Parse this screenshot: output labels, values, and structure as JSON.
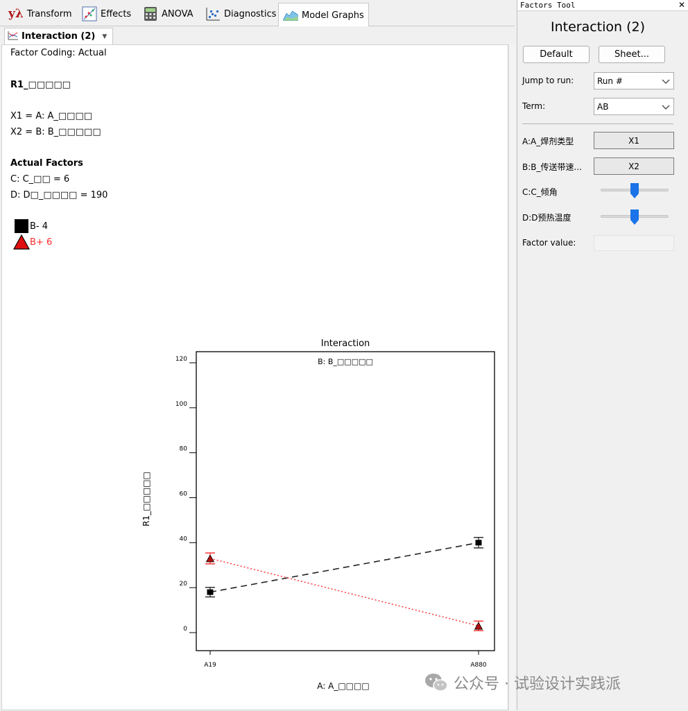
{
  "tabs": [
    {
      "label": "Transform",
      "icon": "transform-icon"
    },
    {
      "label": "Effects",
      "icon": "effects-icon"
    },
    {
      "label": "ANOVA",
      "icon": "calculator-icon"
    },
    {
      "label": "Diagnostics",
      "icon": "diagnostics-icon"
    },
    {
      "label": "Model Graphs",
      "icon": "model-graphs-icon"
    }
  ],
  "transform_glyph": "yλ",
  "subtab": {
    "label": "Interaction (2)"
  },
  "report": {
    "coding": "Factor Coding: Actual",
    "response": "R1_□□□□□",
    "x1": "X1 = A: A_□□□□",
    "x2": "X2 = B: B_□□□□□",
    "actual_factors_heading": "Actual Factors",
    "factor_c": "C: C_□□ = 6",
    "factor_d": "D: D□_□□□□ = 190",
    "legend_low": "B- 4",
    "legend_high": "B+ 6"
  },
  "colors": {
    "series_low": "#222222",
    "series_high": "#ff2a2a",
    "accent": "#1a73e8"
  },
  "chart_data": {
    "type": "line",
    "title": "Interaction",
    "subtitle": "B: B_□□□□□",
    "xlabel": "A: A_□□□□",
    "ylabel": "R1_□□□□□",
    "categories": [
      "A19",
      "A880"
    ],
    "ylim": [
      0,
      120
    ],
    "yticks": [
      "0",
      "20",
      "40",
      "60",
      "80",
      "100",
      "120"
    ],
    "series": [
      {
        "name": "B- 4",
        "values": [
          18,
          40
        ],
        "color": "#222222",
        "style": "dashed",
        "marker": "square",
        "error": [
          1.2,
          1.4
        ]
      },
      {
        "name": "B+ 6",
        "values": [
          33,
          3
        ],
        "color": "#ff2a2a",
        "style": "dotted",
        "marker": "triangle",
        "error": [
          1.5,
          1.2
        ]
      }
    ],
    "grid": false,
    "legend": "top-left"
  },
  "factors_tool": {
    "window_title": "Factors Tool",
    "heading": "Interaction (2)",
    "default_button": "Default",
    "sheet_button": "Sheet...",
    "jump_label": "Jump to run:",
    "jump_value": "Run #",
    "term_label": "Term:",
    "term_value": "AB",
    "factor_a_label": "A:A_焊剂类型",
    "factor_a_value": "X1",
    "factor_b_label": "B:B_传送带速...",
    "factor_b_value": "X2",
    "factor_c_label": "C:C_倾角",
    "factor_c_level": 0.5,
    "factor_d_label": "D:D预热温度",
    "factor_d_level": 0.5,
    "factor_value_label": "Factor value:"
  },
  "watermark": "公众号 · 试验设计实践派"
}
